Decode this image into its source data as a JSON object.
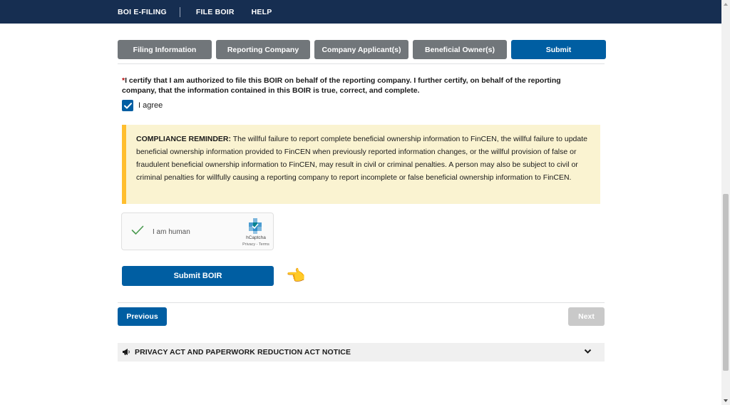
{
  "header": {
    "nav": [
      "BOI E-FILING",
      "FILE BOIR",
      "HELP"
    ]
  },
  "steps": [
    "Filing Information",
    "Reporting Company",
    "Company Applicant(s)",
    "Beneficial Owner(s)",
    "Submit"
  ],
  "active_step": "Submit",
  "certification": {
    "required_marker": "*",
    "text": "I certify that I am authorized to file this BOIR on behalf of the reporting company. I further certify, on behalf of the reporting company, that the information contained in this BOIR is true, correct, and complete.",
    "checkbox_label": "I agree",
    "checked": true
  },
  "compliance": {
    "heading": "COMPLIANCE REMINDER:",
    "body": " The willful failure to report complete beneficial ownership information to FinCEN, the willful failure to update beneficial ownership information provided to FinCEN when previously reported information changes, or the willful provision of false or fraudulent beneficial ownership information to FinCEN, may result in civil or criminal penalties. A person may also be subject to civil or criminal penalties for willfully causing a reporting company to report incomplete or false beneficial ownership information to FinCEN."
  },
  "captcha": {
    "label": "I am human",
    "brand": "hCaptcha",
    "terms": "Privacy - Terms",
    "status": "verified"
  },
  "actions": {
    "submit": "Submit BOIR",
    "previous": "Previous",
    "next": "Next"
  },
  "accordion": {
    "title": "PRIVACY ACT AND PAPERWORK REDUCTION ACT NOTICE"
  },
  "colors": {
    "header_bg": "#162e51",
    "primary": "#005ea2",
    "step_inactive": "#71767a",
    "alert_bg": "#faf3d1",
    "alert_border": "#ffbe2e"
  },
  "icons": [
    "checkmark-icon",
    "hcaptcha-logo-icon",
    "pointing-hand-icon",
    "megaphone-icon",
    "chevron-down-icon"
  ]
}
